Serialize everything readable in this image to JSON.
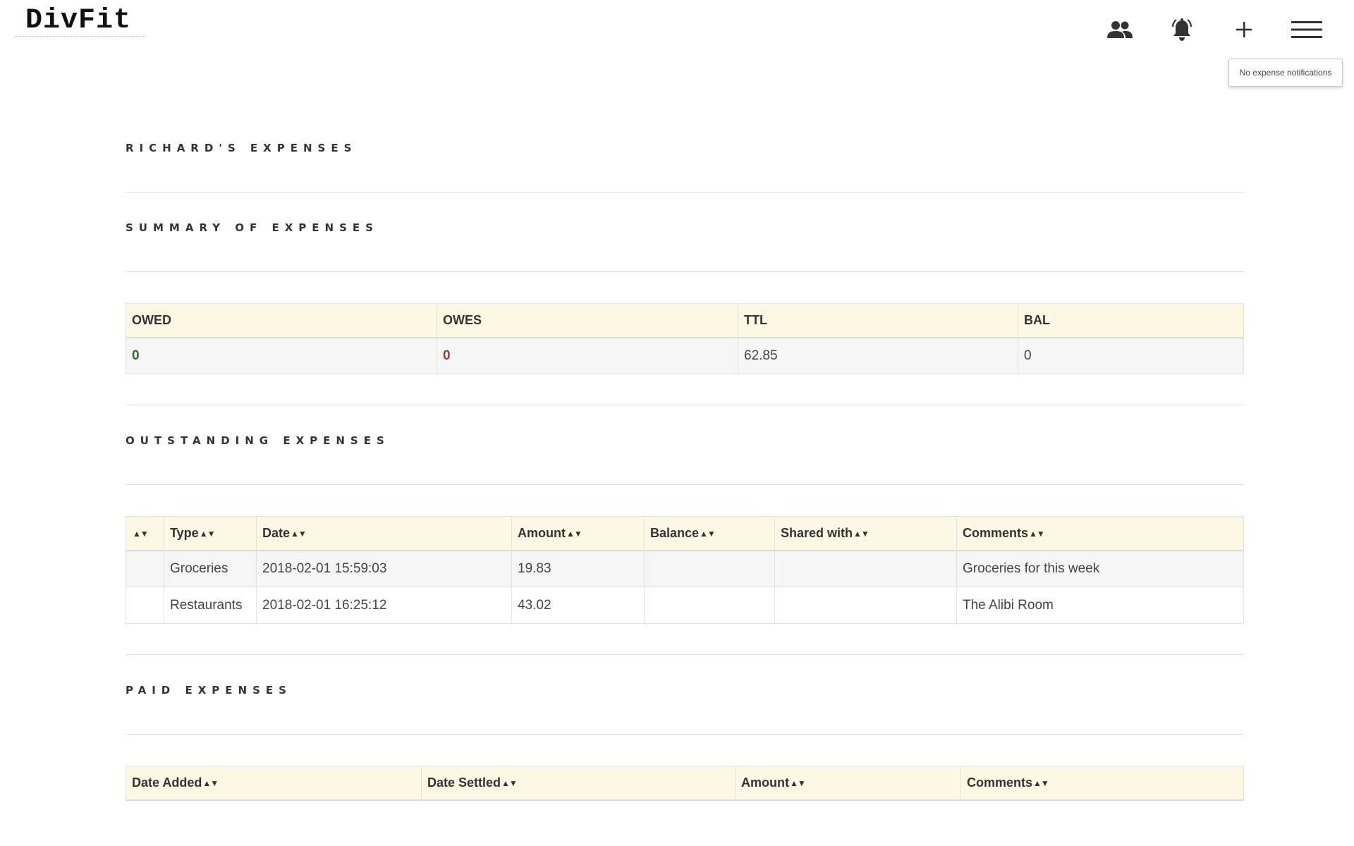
{
  "app": {
    "logo": "DivFit"
  },
  "nav": {
    "users_icon": "users-icon",
    "bell_icon": "bell-icon",
    "plus_icon": "plus-icon",
    "menu_icon": "hamburger-menu-icon",
    "tooltip": "No expense notifications"
  },
  "sections": {
    "user_title": "Richard's Expenses",
    "summary_title": "Summary of Expenses",
    "outstanding_title": "Outstanding Expenses",
    "paid_title": "Paid Expenses"
  },
  "summary": {
    "headers": [
      "OWED",
      "OWES",
      "TTL",
      "BAL"
    ],
    "values": [
      "0",
      "0",
      "62.85",
      "0"
    ],
    "colors": {
      "owed": "#2f6b2f",
      "owes": "#a33a3a"
    }
  },
  "outstanding": {
    "headers": [
      "",
      "Type",
      "Date",
      "Amount",
      "Balance",
      "Shared with",
      "Comments"
    ],
    "rows": [
      [
        "",
        "Groceries",
        "2018-02-01 15:59:03",
        "19.83",
        "",
        "",
        "Groceries for this week"
      ],
      [
        "",
        "Restaurants",
        "2018-02-01 16:25:12",
        "43.02",
        "",
        "",
        "The Alibi Room"
      ]
    ]
  },
  "paid": {
    "headers": [
      "Date Added",
      "Date Settled",
      "Amount",
      "Comments"
    ]
  },
  "colors": {
    "header_bg": "#fcf8e3",
    "row_shade": "#f5f5f5"
  }
}
